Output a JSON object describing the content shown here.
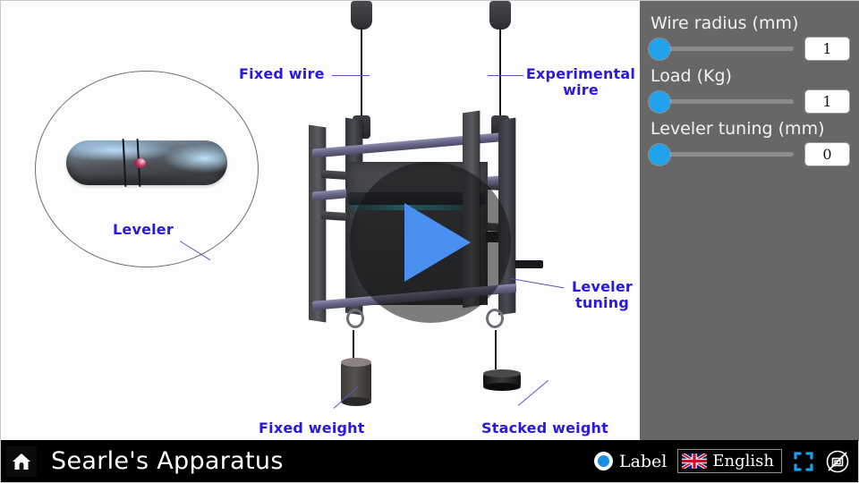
{
  "app": {
    "title": "Searle's Apparatus"
  },
  "stage": {
    "annotations": [
      {
        "id": "fixed-wire",
        "text": "Fixed wire"
      },
      {
        "id": "experimental-wire",
        "text": "Experimental\nwire"
      },
      {
        "id": "leveler",
        "text": "Leveler"
      },
      {
        "id": "leveler-tuning",
        "text": "Leveler\ntuning"
      },
      {
        "id": "fixed-weight",
        "text": "Fixed weight"
      },
      {
        "id": "stacked-weight",
        "text": "Stacked weight"
      }
    ],
    "play_button": {
      "icon": "play-icon",
      "aria_label": "Play"
    }
  },
  "panel": {
    "controls": [
      {
        "id": "wire-radius",
        "label": "Wire radius (mm)",
        "value": "1",
        "thumb_percent": 0
      },
      {
        "id": "load",
        "label": "Load (Kg)",
        "value": "1",
        "thumb_percent": 0
      },
      {
        "id": "leveler-tuning",
        "label": "Leveler tuning (mm)",
        "value": "0",
        "thumb_percent": 0
      }
    ]
  },
  "bottom_bar": {
    "home_icon": "home-icon",
    "label_toggle": {
      "text": "Label",
      "icon": "radio-selected-icon",
      "selected": true
    },
    "language": {
      "text": "English",
      "icon": "uk-flag-icon"
    },
    "fullscreen_icon": "fullscreen-icon",
    "no-copy_icon": "no-copy-icon"
  },
  "colors": {
    "annotation_blue": "#2a19dc",
    "panel_gray": "#676767",
    "slider_thumb_blue": "#22a2ea",
    "play_triangle_blue": "#4a90f0",
    "bottom_bar": "#000000",
    "radio_blue": "#1a8fe0",
    "fullscreen_blue": "#1aa0ee"
  }
}
